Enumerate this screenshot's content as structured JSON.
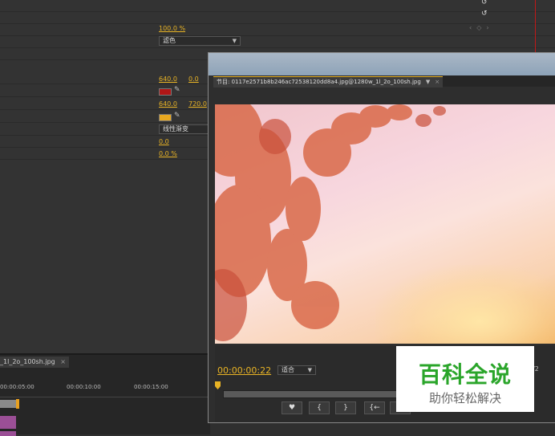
{
  "effect_controls": {
    "opacity_value": "100.0 %",
    "blend_mode": "滤色",
    "start_point_x": "640.0",
    "start_point_y": "0.0",
    "start_color_hex": "#b01616",
    "end_point_x": "640.0",
    "end_point_y": "720.0",
    "end_color_hex": "#e8a820",
    "ramp_shape": "线性渐变",
    "ramp_scatter": "0.0",
    "blend_with_original": "0.0 %"
  },
  "timeline": {
    "tab_label": "_1l_2o_100sh.jpg",
    "times": [
      "00:00:05:00",
      "00:00:10:00",
      "00:00:15:00"
    ]
  },
  "program_monitor": {
    "tab_label": "节目: 0117e2571b8b246ac72538120dd8a4.jpg@1280w_1l_2o_100sh.jpg",
    "timecode": "00:00:00:22",
    "fit_option": "适合",
    "fraction": "/2",
    "buttons": [
      "♥",
      "{",
      "}",
      "{←"
    ]
  },
  "watermark": {
    "title": "百科全说",
    "subtitle": "助你轻松解决"
  }
}
